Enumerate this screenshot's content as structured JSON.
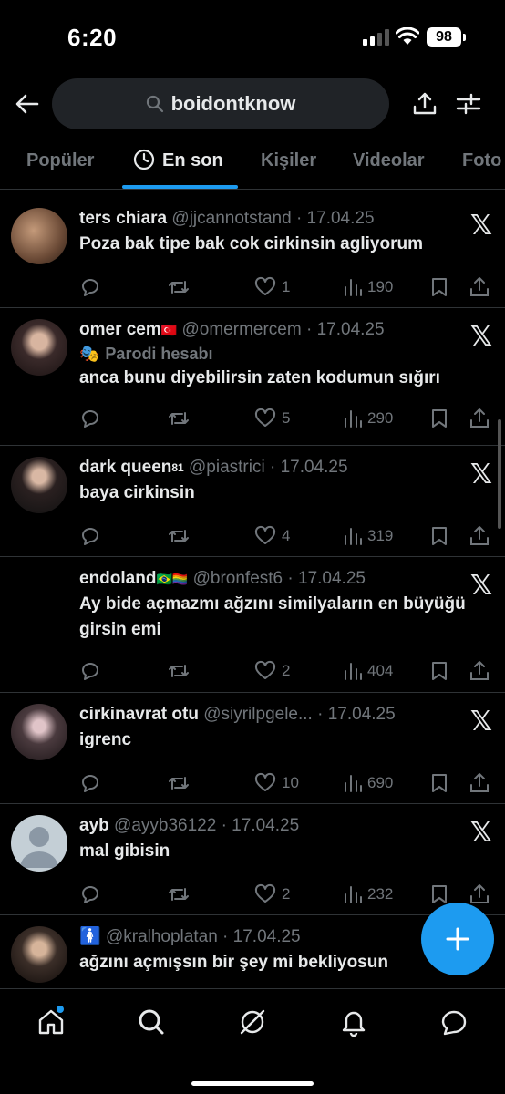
{
  "status_bar": {
    "time": "6:20",
    "battery": "98"
  },
  "search": {
    "query": "boidontknow"
  },
  "tabs": [
    {
      "label": "Popüler"
    },
    {
      "label": "En son"
    },
    {
      "label": "Kişiler"
    },
    {
      "label": "Videolar"
    },
    {
      "label": "Foto"
    }
  ],
  "tweets": [
    {
      "name": "ters chiara",
      "handle": "@jjcannotstand",
      "date": "· 17.04.25",
      "text": "Poza bak tipe bak cok cirkinsin agliyorum",
      "replies": "",
      "retweets": "",
      "likes": "1",
      "views": "190",
      "avatar_color": "#6b4a36"
    },
    {
      "name": "omer cem",
      "flag": "🇹🇷",
      "handle": "@omermercem",
      "date": "· 17.04.25",
      "parody": "Parodi hesabı",
      "text": "anca bunu diyebilirsin zaten kodumun sığırı",
      "likes": "5",
      "views": "290",
      "avatar_color": "#3a2a2a"
    },
    {
      "name": "dark queen",
      "sup": "81",
      "handle": "@piastrici",
      "date": "· 17.04.25",
      "text": "baya cirkinsin",
      "likes": "4",
      "views": "319",
      "avatar_color": "#2a2020"
    },
    {
      "name": "endoland",
      "flag": "🇧🇷🏳️‍🌈",
      "handle": "@bronfest6",
      "date": "· 17.04.25",
      "text": "Ay bide açmazmı ağzını similyaların en büyüğü girsin emi",
      "likes": "2",
      "views": "404",
      "avatar_color": "#000000"
    },
    {
      "name": "cirkinavrat otu",
      "handle": "@siyrilpgele...",
      "date": "· 17.04.25",
      "text": "igrenc",
      "likes": "10",
      "views": "690",
      "avatar_color": "#4a3a3e"
    },
    {
      "name": "ayb",
      "handle": "@ayyb36122",
      "date": "· 17.04.25",
      "text": "mal gibisin",
      "likes": "2",
      "views": "232",
      "avatar_color": "#c4cfd6"
    },
    {
      "name": "🚺",
      "handle": "@kralhoplatan",
      "date": "· 17.04.25",
      "text": "ağzını açmışsın bir şey mi bekliyosun",
      "avatar_color": "#3b2e28"
    }
  ],
  "colors": {
    "accent": "#1d9bf0",
    "background": "#000000",
    "muted": "#71767b",
    "divider": "#2f3336"
  },
  "icons": [
    "back-arrow-icon",
    "search-icon",
    "share-icon",
    "filter-icon",
    "clock-icon",
    "x-logo-icon",
    "reply-icon",
    "retweet-icon",
    "like-icon",
    "views-icon",
    "bookmark-icon",
    "compose-icon",
    "home-icon",
    "grok-icon",
    "notifications-icon",
    "messages-icon"
  ]
}
